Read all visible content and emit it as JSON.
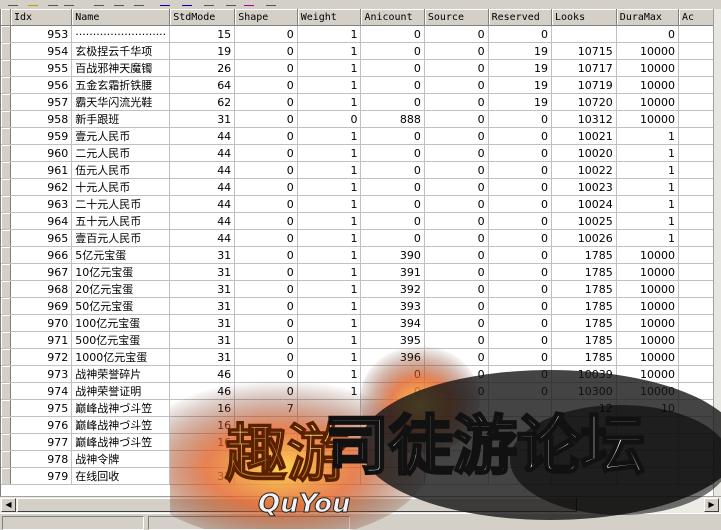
{
  "columns": [
    "Idx",
    "Name",
    "StdMode",
    "Shape",
    "Weight",
    "Anicount",
    "Source",
    "Reserved",
    "Looks",
    "DuraMax",
    "Ac"
  ],
  "rows": [
    [
      "953",
      "··························",
      "15",
      "0",
      "1",
      "0",
      "0",
      "0",
      "",
      "0",
      ""
    ],
    [
      "954",
      "玄极捏云千华项",
      "19",
      "0",
      "1",
      "0",
      "0",
      "19",
      "10715",
      "10000",
      ""
    ],
    [
      "955",
      "百战邪神天魔镯",
      "26",
      "0",
      "1",
      "0",
      "0",
      "19",
      "10717",
      "10000",
      ""
    ],
    [
      "956",
      "五金玄霜折铁腰",
      "64",
      "0",
      "1",
      "0",
      "0",
      "19",
      "10719",
      "10000",
      ""
    ],
    [
      "957",
      "霸天华闪流光鞋",
      "62",
      "0",
      "1",
      "0",
      "0",
      "19",
      "10720",
      "10000",
      ""
    ],
    [
      "958",
      "新手跟班",
      "31",
      "0",
      "0",
      "888",
      "0",
      "0",
      "10312",
      "10000",
      ""
    ],
    [
      "959",
      "壹元人民币",
      "44",
      "0",
      "1",
      "0",
      "0",
      "0",
      "10021",
      "1",
      ""
    ],
    [
      "960",
      "二元人民币",
      "44",
      "0",
      "1",
      "0",
      "0",
      "0",
      "10020",
      "1",
      ""
    ],
    [
      "961",
      "伍元人民币",
      "44",
      "0",
      "1",
      "0",
      "0",
      "0",
      "10022",
      "1",
      ""
    ],
    [
      "962",
      "十元人民币",
      "44",
      "0",
      "1",
      "0",
      "0",
      "0",
      "10023",
      "1",
      ""
    ],
    [
      "963",
      "二十元人民币",
      "44",
      "0",
      "1",
      "0",
      "0",
      "0",
      "10024",
      "1",
      ""
    ],
    [
      "964",
      "五十元人民币",
      "44",
      "0",
      "1",
      "0",
      "0",
      "0",
      "10025",
      "1",
      ""
    ],
    [
      "965",
      "壹百元人民币",
      "44",
      "0",
      "1",
      "0",
      "0",
      "0",
      "10026",
      "1",
      ""
    ],
    [
      "966",
      "5亿元宝蛋",
      "31",
      "0",
      "1",
      "390",
      "0",
      "0",
      "1785",
      "10000",
      ""
    ],
    [
      "967",
      "10亿元宝蛋",
      "31",
      "0",
      "1",
      "391",
      "0",
      "0",
      "1785",
      "10000",
      ""
    ],
    [
      "968",
      "20亿元宝蛋",
      "31",
      "0",
      "1",
      "392",
      "0",
      "0",
      "1785",
      "10000",
      ""
    ],
    [
      "969",
      "50亿元宝蛋",
      "31",
      "0",
      "1",
      "393",
      "0",
      "0",
      "1785",
      "10000",
      ""
    ],
    [
      "970",
      "100亿元宝蛋",
      "31",
      "0",
      "1",
      "394",
      "0",
      "0",
      "1785",
      "10000",
      ""
    ],
    [
      "971",
      "500亿元宝蛋",
      "31",
      "0",
      "1",
      "395",
      "0",
      "0",
      "1785",
      "10000",
      ""
    ],
    [
      "972",
      "1000亿元宝蛋",
      "31",
      "0",
      "1",
      "396",
      "0",
      "0",
      "1785",
      "10000",
      ""
    ],
    [
      "973",
      "战神荣誉碎片",
      "46",
      "0",
      "1",
      "0",
      "0",
      "0",
      "10039",
      "10000",
      ""
    ],
    [
      "974",
      "战神荣誉证明",
      "46",
      "0",
      "1",
      "0",
      "0",
      "0",
      "10300",
      "10000",
      ""
    ],
    [
      "975",
      "巅峰战神づ斗笠",
      "16",
      "7",
      "",
      "",
      "",
      "",
      "12",
      "10",
      ""
    ],
    [
      "976",
      "巅峰战神づ斗笠",
      "16",
      "",
      "",
      "",
      "",
      "",
      "",
      "",
      ""
    ],
    [
      "977",
      "巅峰战神づ斗笠",
      "16",
      "",
      "",
      "",
      "",
      "",
      "",
      "",
      ""
    ],
    [
      "978",
      "战神令牌",
      "",
      "",
      "",
      "",
      "",
      "",
      "",
      "",
      ""
    ],
    [
      "979",
      "在线回收",
      "31",
      "",
      "",
      "",
      "",
      "",
      "",
      "",
      ""
    ]
  ],
  "watermark": {
    "main": "趣游",
    "brand": "司徒游论坛",
    "latin": "QuYou"
  }
}
